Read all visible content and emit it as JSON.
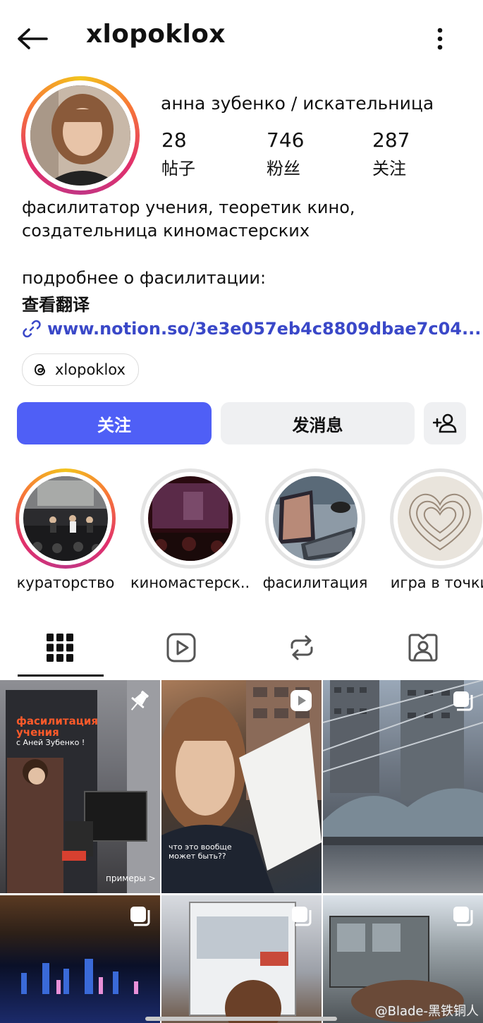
{
  "header": {
    "username": "xlopoklox"
  },
  "profile": {
    "full_name": "анна зубенко / искательница",
    "stats": [
      {
        "value": "28",
        "label": "帖子"
      },
      {
        "value": "746",
        "label": "粉丝"
      },
      {
        "value": "287",
        "label": "关注"
      }
    ],
    "bio_lines": [
      "фасилитатор учения, теоретик кино,",
      "создательница киномастерских",
      "подробнее о фасилитации:"
    ],
    "translate_label": "查看翻译",
    "link_text": "www.notion.so/3e3e057eb4c8809dbae7c04...",
    "threads_handle": "xlopoklox"
  },
  "actions": {
    "follow_label": "关注",
    "message_label": "发消息"
  },
  "highlights": [
    {
      "label": "кураторство",
      "ring": "story"
    },
    {
      "label": "киномастерск...",
      "ring": "seen"
    },
    {
      "label": "фасилитация",
      "ring": "seen"
    },
    {
      "label": "игра в точки",
      "ring": "seen"
    }
  ],
  "tabs": [
    {
      "icon": "grid-icon",
      "selected": true
    },
    {
      "icon": "reels-icon",
      "selected": false
    },
    {
      "icon": "reposts-icon",
      "selected": false
    },
    {
      "icon": "tagged-icon",
      "selected": false
    }
  ],
  "posts": [
    {
      "badge": "pin-icon",
      "title_line1": "фасилитация",
      "title_line2": "учения",
      "subtitle": "с Аней Зубенко !",
      "caption": "примеры >"
    },
    {
      "badge": "reel-icon",
      "caption": "что это вообще может быть??"
    },
    {
      "badge": "carousel-icon"
    },
    {
      "badge": "carousel-icon"
    },
    {
      "badge": "carousel-icon"
    },
    {
      "badge": "carousel-icon"
    }
  ],
  "watermark": "@Blade-黑铁铜人",
  "colors": {
    "accent": "#4f5ff6",
    "link": "#3a48c8",
    "secondary_button": "#eff0f2"
  }
}
